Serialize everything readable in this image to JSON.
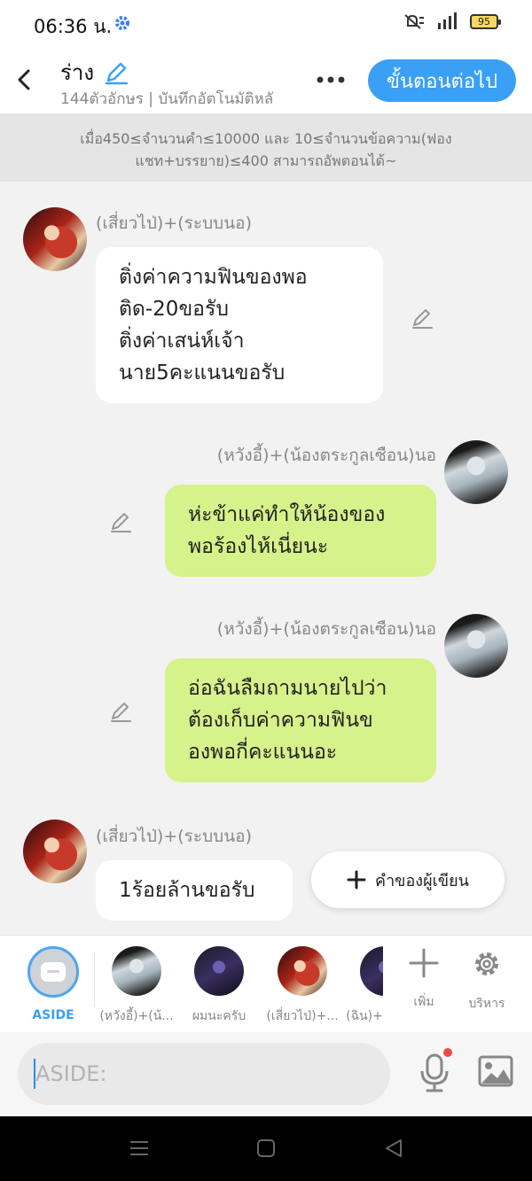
{
  "status": {
    "time": "06:36 น.",
    "battery": "95"
  },
  "header": {
    "title": "ร่าง",
    "subtitle": "144ตัวอักษร | บันทึกอัตโนมัติหลั",
    "next_button": "ขั้นตอนต่อไป"
  },
  "notice": "เมื่อ450≤จำนวนคำ≤10000 และ 10≤จำนวนข้อความ(ฟองแชท+บรรยาย)≤400 สามารถอัพตอนได้~",
  "messages": [
    {
      "sender": "(เสี่ยวไป่)+(ระบบนอ)",
      "side": "left",
      "lines": [
        "ติ่งค่าความฟินของพอ",
        "ติด-20ขอรับ",
        "ติ่งค่าเสน่ห์เจ้า",
        "นาย5คะแนนขอรับ"
      ]
    },
    {
      "sender": "(หวังอี้)+(น้องตระกูลเซือน)นอ",
      "side": "right",
      "lines": [
        "ห่ะข้าแค่ทำให้น้องของ",
        "พอร้องไห้เนี่ยนะ"
      ]
    },
    {
      "sender": "(หวังอี้)+(น้องตระกูลเซือน)นอ",
      "side": "right",
      "lines": [
        "อ่อฉันลืมถามนายไปว่า",
        "ต้องเก็บค่าความฟินข",
        "องพอกี่คะแนนอะ"
      ]
    },
    {
      "sender": "(เสี่ยวไป่)+(ระบบนอ)",
      "side": "left",
      "lines": [
        "1ร้อยล้านขอรับ"
      ]
    }
  ],
  "author_button": "คำของผู้เขียน",
  "characters": [
    {
      "label": "ASIDE"
    },
    {
      "label": "(หวังอี้)+(น้..."
    },
    {
      "label": "ผมนะครับ"
    },
    {
      "label": "(เสี่ยวไป่)+..."
    },
    {
      "label": "(ฉิน)+"
    }
  ],
  "tools": {
    "add_label": "เพิ่ม",
    "manage_label": "บริหาร"
  },
  "input": {
    "placeholder": "ASIDE:"
  },
  "colors": {
    "accent": "#3aa0f5",
    "bubble_green": "#d6f28a",
    "bubble_white": "#ffffff",
    "mic_dot": "#f04848"
  }
}
